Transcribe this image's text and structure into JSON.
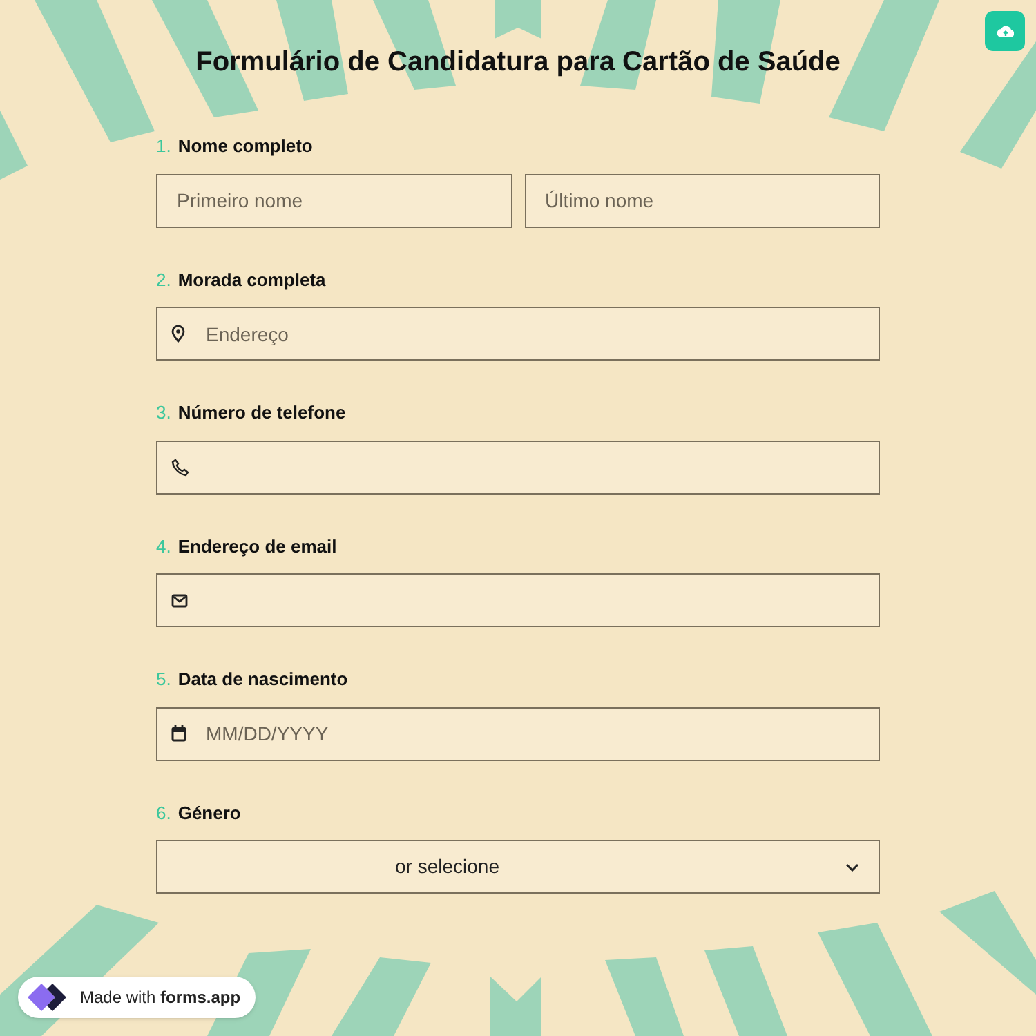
{
  "title": "Formulário de Candidatura para Cartão de Saúde",
  "questions": [
    {
      "number": "1.",
      "label": "Nome completo",
      "kind": "name",
      "fields": [
        {
          "placeholder": "Primeiro nome"
        },
        {
          "placeholder": "Último nome"
        }
      ]
    },
    {
      "number": "2.",
      "label": "Morada completa",
      "kind": "address",
      "fields": [
        {
          "placeholder": "Endereço"
        }
      ]
    },
    {
      "number": "3.",
      "label": "Número de telefone",
      "kind": "phone"
    },
    {
      "number": "4.",
      "label": "Endereço de email",
      "kind": "email"
    },
    {
      "number": "5.",
      "label": "Data de nascimento",
      "kind": "date",
      "fields": [
        {
          "placeholder": "MM/DD/YYYY"
        }
      ]
    },
    {
      "number": "6.",
      "label": "Género",
      "kind": "select",
      "fields": [
        {
          "value": "or selecione"
        }
      ]
    }
  ],
  "badge": "Made with **forms.app**"
}
